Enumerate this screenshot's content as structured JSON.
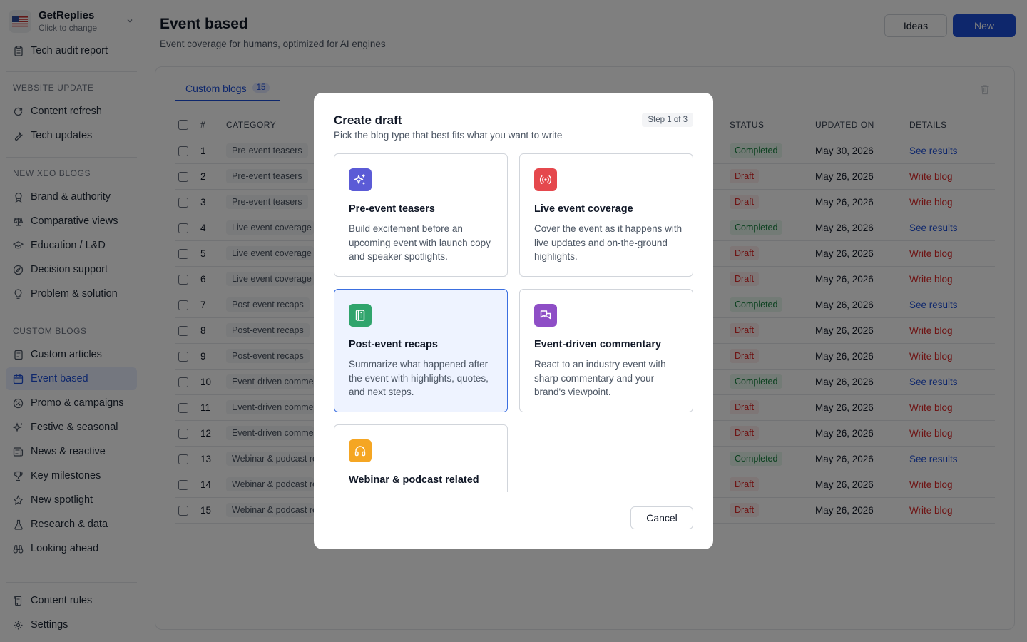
{
  "workspace": {
    "name": "GetReplies",
    "subtitle": "Click to change"
  },
  "sidebar": {
    "top_items": [
      {
        "label": "Tech audit report",
        "icon": "clipboard-icon"
      }
    ],
    "sections": [
      {
        "title": "WEBSITE UPDATE",
        "items": [
          {
            "label": "Content refresh",
            "icon": "refresh-icon"
          },
          {
            "label": "Tech updates",
            "icon": "wrench-icon"
          }
        ]
      },
      {
        "title": "NEW XEO BLOGS",
        "items": [
          {
            "label": "Brand & authority",
            "icon": "award-icon"
          },
          {
            "label": "Comparative views",
            "icon": "scale-icon"
          },
          {
            "label": "Education / L&D",
            "icon": "graduation-cap-icon"
          },
          {
            "label": "Decision support",
            "icon": "compass-icon"
          },
          {
            "label": "Problem & solution",
            "icon": "lightbulb-icon"
          }
        ]
      },
      {
        "title": "CUSTOM BLOGS",
        "items": [
          {
            "label": "Custom articles",
            "icon": "document-icon"
          },
          {
            "label": "Event based",
            "icon": "calendar-icon",
            "active": true
          },
          {
            "label": "Promo & campaigns",
            "icon": "badge-percent-icon"
          },
          {
            "label": "Festive & seasonal",
            "icon": "sparkles-icon"
          },
          {
            "label": "News & reactive",
            "icon": "newspaper-icon"
          },
          {
            "label": "Key milestones",
            "icon": "trophy-icon"
          },
          {
            "label": "New spotlight",
            "icon": "star-icon"
          },
          {
            "label": "Research & data",
            "icon": "flask-icon"
          },
          {
            "label": "Looking ahead",
            "icon": "binoculars-icon"
          }
        ]
      }
    ],
    "bottom_items": [
      {
        "label": "Content rules",
        "icon": "scroll-icon"
      },
      {
        "label": "Settings",
        "icon": "gear-icon"
      }
    ]
  },
  "header": {
    "title": "Event based",
    "subtitle": "Event coverage for humans, optimized for AI engines",
    "ideas_label": "Ideas",
    "new_label": "New"
  },
  "tab": {
    "label": "Custom blogs",
    "count": "15"
  },
  "table": {
    "columns": {
      "num": "#",
      "category": "CATEGORY",
      "status": "STATUS",
      "updated": "UPDATED ON",
      "details": "DETAILS"
    },
    "rows": [
      {
        "num": "1",
        "category": "Pre-event teasers",
        "status": "Completed",
        "updated": "May 30, 2026",
        "details": "See results"
      },
      {
        "num": "2",
        "category": "Pre-event teasers",
        "status": "Draft",
        "updated": "May 26, 2026",
        "details": "Write blog"
      },
      {
        "num": "3",
        "category": "Pre-event teasers",
        "status": "Draft",
        "updated": "May 26, 2026",
        "details": "Write blog"
      },
      {
        "num": "4",
        "category": "Live event coverage",
        "status": "Completed",
        "updated": "May 26, 2026",
        "details": "See results"
      },
      {
        "num": "5",
        "category": "Live event coverage",
        "status": "Draft",
        "updated": "May 26, 2026",
        "details": "Write blog"
      },
      {
        "num": "6",
        "category": "Live event coverage",
        "status": "Draft",
        "updated": "May 26, 2026",
        "details": "Write blog"
      },
      {
        "num": "7",
        "category": "Post-event recaps",
        "status": "Completed",
        "updated": "May 26, 2026",
        "details": "See results"
      },
      {
        "num": "8",
        "category": "Post-event recaps",
        "status": "Draft",
        "updated": "May 26, 2026",
        "details": "Write blog"
      },
      {
        "num": "9",
        "category": "Post-event recaps",
        "status": "Draft",
        "updated": "May 26, 2026",
        "details": "Write blog"
      },
      {
        "num": "10",
        "category": "Event-driven commentary",
        "status": "Completed",
        "updated": "May 26, 2026",
        "details": "See results"
      },
      {
        "num": "11",
        "category": "Event-driven commentary",
        "status": "Draft",
        "updated": "May 26, 2026",
        "details": "Write blog"
      },
      {
        "num": "12",
        "category": "Event-driven commentary",
        "status": "Draft",
        "updated": "May 26, 2026",
        "details": "Write blog"
      },
      {
        "num": "13",
        "category": "Webinar & podcast related",
        "status": "Completed",
        "updated": "May 26, 2026",
        "details": "See results"
      },
      {
        "num": "14",
        "category": "Webinar & podcast related",
        "status": "Draft",
        "updated": "May 26, 2026",
        "details": "Write blog"
      },
      {
        "num": "15",
        "category": "Webinar & podcast related",
        "status": "Draft",
        "updated": "May 26, 2026",
        "details": "Write blog"
      }
    ]
  },
  "modal": {
    "title": "Create draft",
    "subtitle": "Pick the blog type that best fits what you want to write",
    "step": "Step 1 of 3",
    "cancel_label": "Cancel",
    "options": [
      {
        "title": "Pre-event teasers",
        "desc": "Build excitement before an upcoming event with launch copy and speaker spotlights.",
        "icon": "sparkles-icon",
        "color": "#5b5bd6"
      },
      {
        "title": "Live event coverage",
        "desc": "Cover the event as it happens with live updates and on-the-ground highlights.",
        "icon": "broadcast-icon",
        "color": "#e5484d"
      },
      {
        "title": "Post-event recaps",
        "desc": "Summarize what happened after the event with highlights, quotes, and next steps.",
        "icon": "notebook-icon",
        "color": "#30a46c",
        "selected": true
      },
      {
        "title": "Event-driven commentary",
        "desc": "React to an industry event with sharp commentary and your brand's viewpoint.",
        "icon": "chat-bubbles-icon",
        "color": "#8e4ec6"
      },
      {
        "title": "Webinar & podcast related",
        "desc": "",
        "icon": "headphones-icon",
        "color": "#f5a623"
      }
    ]
  }
}
